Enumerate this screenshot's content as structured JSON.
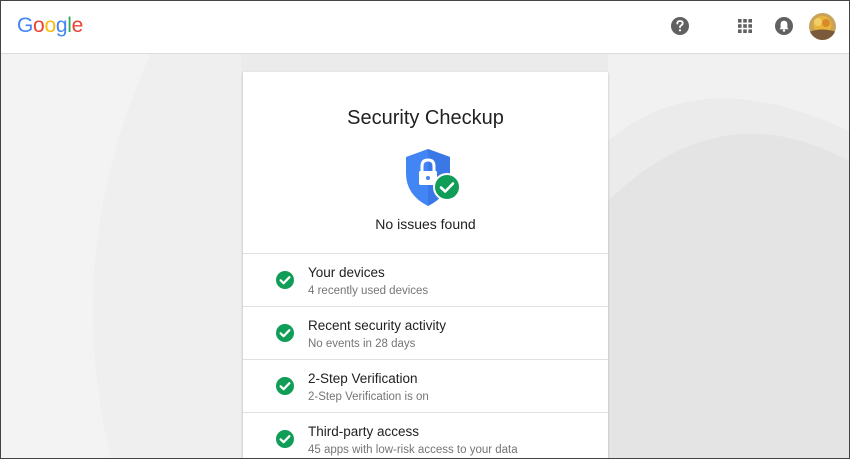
{
  "header": {
    "logo_letters": [
      {
        "ch": "G",
        "color": "#4285F4"
      },
      {
        "ch": "o",
        "color": "#EA4335"
      },
      {
        "ch": "o",
        "color": "#FBBC05"
      },
      {
        "ch": "g",
        "color": "#4285F4"
      },
      {
        "ch": "l",
        "color": "#34A853"
      },
      {
        "ch": "e",
        "color": "#EA4335"
      }
    ],
    "icons": [
      "help-icon",
      "apps-icon",
      "notifications-icon",
      "avatar"
    ]
  },
  "card": {
    "title": "Security Checkup",
    "status": "No issues found",
    "shield_color": "#4285F4",
    "check_color": "#0F9D58",
    "items": [
      {
        "title": "Your devices",
        "subtitle": "4 recently used devices"
      },
      {
        "title": "Recent security activity",
        "subtitle": "No events in 28 days"
      },
      {
        "title": "2-Step Verification",
        "subtitle": "2-Step Verification is on"
      },
      {
        "title": "Third-party access",
        "subtitle": "45 apps with low-risk access to your data"
      }
    ]
  }
}
